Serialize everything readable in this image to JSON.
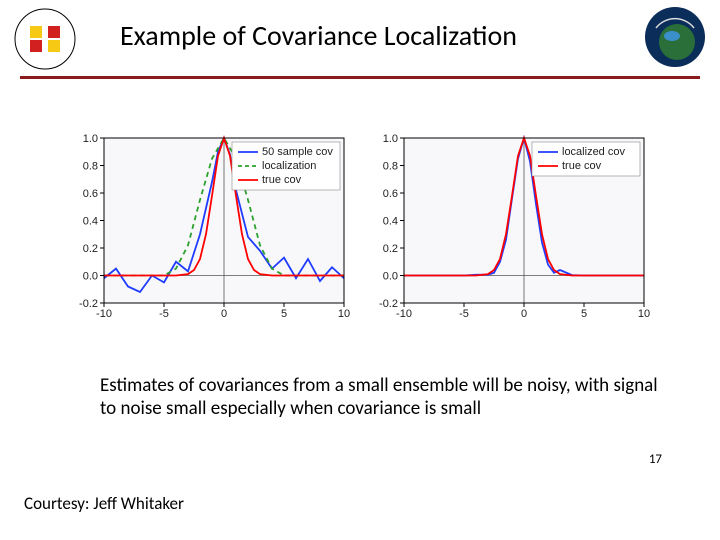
{
  "title": "Example of Covariance Localization",
  "body_text": "Estimates of covariances from a small ensemble will be noisy, with signal to noise small especially when covariance is small",
  "page_number": "17",
  "courtesy": "Courtesy: Jeff Whitaker",
  "logos": {
    "left_alt": "University of Maryland seal",
    "right_alt": "JCSDA badge"
  },
  "chart_data": [
    {
      "type": "line",
      "xlim": [
        -10,
        10
      ],
      "ylim": [
        -0.2,
        1.0
      ],
      "xticks": [
        -10,
        -5,
        0,
        5,
        10
      ],
      "yticks": [
        -0.2,
        0.0,
        0.2,
        0.4,
        0.6,
        0.8,
        1.0
      ],
      "legend": {
        "items": [
          {
            "name": "50 sample cov",
            "color": "#1f3cff",
            "style": "solid"
          },
          {
            "name": "localization",
            "color": "#2ca02c",
            "style": "dashed"
          },
          {
            "name": "true cov",
            "color": "#ff0000",
            "style": "solid"
          }
        ]
      },
      "series": [
        {
          "name": "50 sample cov",
          "color": "#1f3cff",
          "style": "solid",
          "x": [
            -10,
            -9,
            -8,
            -7,
            -6,
            -5,
            -4,
            -3,
            -2,
            -1,
            -0.5,
            0,
            0.5,
            1,
            2,
            3,
            4,
            5,
            6,
            7,
            8,
            9,
            10
          ],
          "y": [
            -0.02,
            0.05,
            -0.08,
            -0.12,
            0.0,
            -0.05,
            0.1,
            0.03,
            0.3,
            0.68,
            0.9,
            1.0,
            0.88,
            0.62,
            0.28,
            0.18,
            0.05,
            0.13,
            -0.02,
            0.12,
            -0.04,
            0.06,
            -0.02
          ]
        },
        {
          "name": "localization",
          "color": "#2ca02c",
          "style": "dashed",
          "x": [
            -10,
            -8,
            -6,
            -5,
            -4,
            -3,
            -2,
            -1,
            0,
            1,
            2,
            3,
            4,
            5,
            6,
            8,
            10
          ],
          "y": [
            0,
            0,
            0,
            0,
            0.05,
            0.22,
            0.55,
            0.85,
            1.0,
            0.85,
            0.55,
            0.22,
            0.05,
            0,
            0,
            0,
            0
          ]
        },
        {
          "name": "true cov",
          "color": "#ff0000",
          "style": "solid",
          "x": [
            -10,
            -8,
            -6,
            -5,
            -4,
            -3,
            -2.5,
            -2,
            -1.5,
            -1,
            -0.5,
            0,
            0.5,
            1,
            1.5,
            2,
            2.5,
            3,
            4,
            5,
            6,
            8,
            10
          ],
          "y": [
            0,
            0,
            0,
            0,
            0,
            0.01,
            0.04,
            0.12,
            0.3,
            0.58,
            0.87,
            1.0,
            0.87,
            0.58,
            0.3,
            0.12,
            0.04,
            0.01,
            0,
            0,
            0,
            0,
            0
          ]
        }
      ]
    },
    {
      "type": "line",
      "xlim": [
        -10,
        10
      ],
      "ylim": [
        -0.2,
        1.0
      ],
      "xticks": [
        -10,
        -5,
        0,
        5,
        10
      ],
      "yticks": [
        -0.2,
        0.0,
        0.2,
        0.4,
        0.6,
        0.8,
        1.0
      ],
      "legend": {
        "items": [
          {
            "name": "localized cov",
            "color": "#1f3cff",
            "style": "solid"
          },
          {
            "name": "true cov",
            "color": "#ff0000",
            "style": "solid"
          }
        ]
      },
      "series": [
        {
          "name": "localized cov",
          "color": "#1f3cff",
          "style": "solid",
          "x": [
            -10,
            -8,
            -6,
            -5,
            -4,
            -3,
            -2.5,
            -2,
            -1.5,
            -1,
            -0.5,
            0,
            0.5,
            1,
            1.5,
            2,
            2.5,
            3,
            4,
            5,
            6,
            8,
            10
          ],
          "y": [
            0,
            0,
            0,
            0,
            0.005,
            0.006,
            0.02,
            0.1,
            0.26,
            0.56,
            0.85,
            1.0,
            0.83,
            0.52,
            0.24,
            0.08,
            0.02,
            0.04,
            0.003,
            0,
            0,
            0,
            0
          ]
        },
        {
          "name": "true cov",
          "color": "#ff0000",
          "style": "solid",
          "x": [
            -10,
            -8,
            -6,
            -5,
            -4,
            -3,
            -2.5,
            -2,
            -1.5,
            -1,
            -0.5,
            0,
            0.5,
            1,
            1.5,
            2,
            2.5,
            3,
            4,
            5,
            6,
            8,
            10
          ],
          "y": [
            0,
            0,
            0,
            0,
            0,
            0.01,
            0.04,
            0.12,
            0.3,
            0.58,
            0.87,
            1.0,
            0.87,
            0.58,
            0.3,
            0.12,
            0.04,
            0.01,
            0,
            0,
            0,
            0,
            0
          ]
        }
      ]
    }
  ]
}
